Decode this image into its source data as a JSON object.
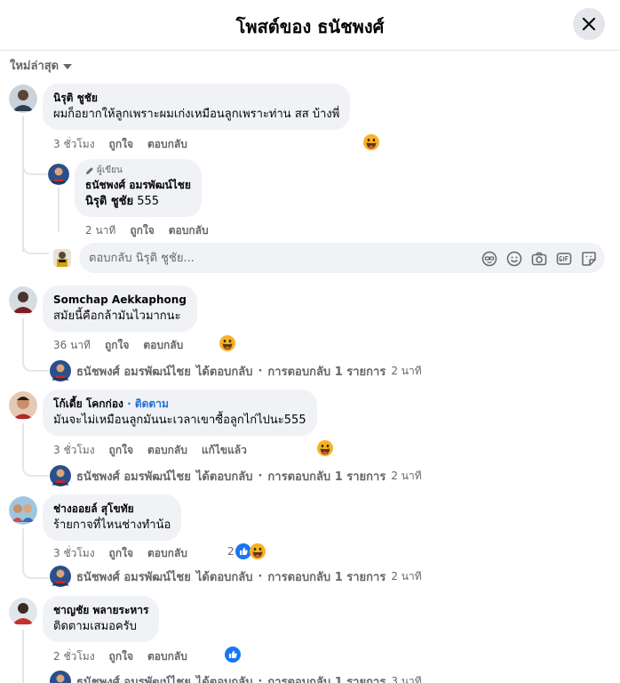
{
  "header": {
    "title": "โพสต์ของ ธนัชพงศ์"
  },
  "sort": {
    "label": "ใหม่ล่าสุด"
  },
  "comments": [
    {
      "name": "นิรุติ ชูชัย",
      "text": "ผมก็อยากให้ลูกเพราะผมเก่งเหมือนลูกเพราะท่าน สส บ้างพี่",
      "time": "3 ชั่วโมง",
      "like": "ถูกใจ",
      "reply": "ตอบกลับ",
      "reply_item": {
        "author_tag": "ผู้เขียน",
        "name": "ธนัชพงศ์ อมรพัฒน์ไชย",
        "mention": "นิรุติ ชูชัย",
        "text": "555",
        "time": "2 นาที",
        "like": "ถูกใจ",
        "reply": "ตอบกลับ"
      },
      "reply_input": {
        "placeholder": "ตอบกลับ นิรุติ ชูชัย..."
      }
    },
    {
      "name": "Somchap Aekkaphong",
      "text": "สมัยนี้คือกล้ามันไวมากนะ",
      "time": "36 นาที",
      "like": "ถูกใจ",
      "reply": "ตอบกลับ",
      "replies_summary": {
        "name": "ธนัชพงศ์ อมรพัฒน์ไชย",
        "action": "ได้ตอบกลับ",
        "count": "การตอบกลับ 1 รายการ",
        "ago": "2 นาที"
      }
    },
    {
      "name": "โก้เดี้ย โคกก่อง",
      "follow": "ติดตาม",
      "text": "มันจะไม่เหมือนลูกมันนะเวลาเขาซื้อลูกไก่ไปนะ555",
      "time": "3 ชั่วโมง",
      "like": "ถูกใจ",
      "reply": "ตอบกลับ",
      "edited": "แก้ไขแล้ว",
      "replies_summary": {
        "name": "ธนัชพงศ์ อมรพัฒน์ไชย",
        "action": "ได้ตอบกลับ",
        "count": "การตอบกลับ 1 รายการ",
        "ago": "2 นาที"
      }
    },
    {
      "name": "ช่างออยล์ สุโขทัย",
      "text": "ร้ายกาจที่ไหนช่างทำน้อ",
      "time": "3 ชั่วโมง",
      "like": "ถูกใจ",
      "reply": "ตอบกลับ",
      "reaction_count": "2",
      "replies_summary": {
        "name": "ธนัชพงศ์ อมรพัฒน์ไชย",
        "action": "ได้ตอบกลับ",
        "count": "การตอบกลับ 1 รายการ",
        "ago": "2 นาที"
      }
    },
    {
      "name": "ชาญชัย พลายระหาร",
      "text": "ติดตามเสมอครับ",
      "time": "2 ชั่วโมง",
      "like": "ถูกใจ",
      "reply": "ตอบกลับ",
      "replies_summary": {
        "name": "ธนัชพงศ์ อมรพัฒน์ไชย",
        "action": "ได้ตอบกลับ",
        "count": "การตอบกลับ 1 รายการ",
        "ago": "3 นาที"
      }
    }
  ],
  "icons": [
    "close-icon",
    "chevron-down-icon",
    "haha-reaction-icon",
    "like-reaction-icon",
    "avatar-icon",
    "sticker-icon",
    "emoji-icon",
    "camera-icon",
    "gif-icon",
    "pencil-icon"
  ],
  "colors": {
    "accent": "#1877f2",
    "bubble": "#f0f2f5",
    "meta": "#65676b",
    "haha": "#f7b125",
    "follow": "#216fdb"
  }
}
